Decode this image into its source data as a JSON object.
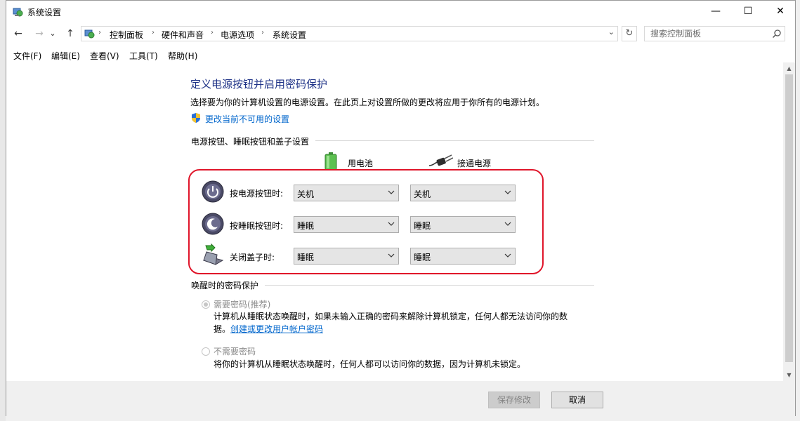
{
  "window": {
    "title": "系统设置"
  },
  "window_controls": {
    "minimize": "—",
    "maximize": "☐",
    "close": "✕"
  },
  "nav": {
    "back": "←",
    "forward": "→",
    "recent": "⌄",
    "up": "↑",
    "refresh": "↻",
    "dropdown": "⌄"
  },
  "breadcrumb": [
    "控制面板",
    "硬件和声音",
    "电源选项",
    "系统设置"
  ],
  "breadcrumb_sep": "›",
  "search": {
    "placeholder": "搜索控制面板"
  },
  "menu": [
    "文件(F)",
    "编辑(E)",
    "查看(V)",
    "工具(T)",
    "帮助(H)"
  ],
  "main": {
    "heading": "定义电源按钮并启用密码保护",
    "description": "选择要为你的计算机设置的电源设置。在此页上对设置所做的更改将应用于你所有的电源计划。",
    "change_link": "更改当前不可用的设置",
    "buttons_section": {
      "title": "电源按钮、睡眠按钮和盖子设置",
      "col_battery": "用电池",
      "col_plugged": "接通电源",
      "rows": [
        {
          "label": "按电源按钮时:",
          "battery": "关机",
          "plugged": "关机",
          "icon": "power-button-icon"
        },
        {
          "label": "按睡眠按钮时:",
          "battery": "睡眠",
          "plugged": "睡眠",
          "icon": "sleep-button-icon"
        },
        {
          "label": "关闭盖子时:",
          "battery": "睡眠",
          "plugged": "睡眠",
          "icon": "laptop-lid-icon"
        }
      ]
    },
    "password_section": {
      "title": "唤醒时的密码保护",
      "option_require": "需要密码(推荐)",
      "require_text": "计算机从睡眠状态唤醒时，如果未输入正确的密码来解除计算机锁定，任何人都无法访问你的数",
      "require_text2": "据。",
      "require_link": "创建或更改用户帐户密码",
      "option_none": "不需要密码",
      "none_text": "将你的计算机从睡眠状态唤醒时，任何人都可以访问你的数据，因为计算机未锁定。",
      "selected": "require"
    }
  },
  "footer": {
    "save": "保存修改",
    "cancel": "取消"
  },
  "colors": {
    "heading": "#1e3287",
    "link": "#0066cc",
    "highlight": "#e0152a"
  }
}
